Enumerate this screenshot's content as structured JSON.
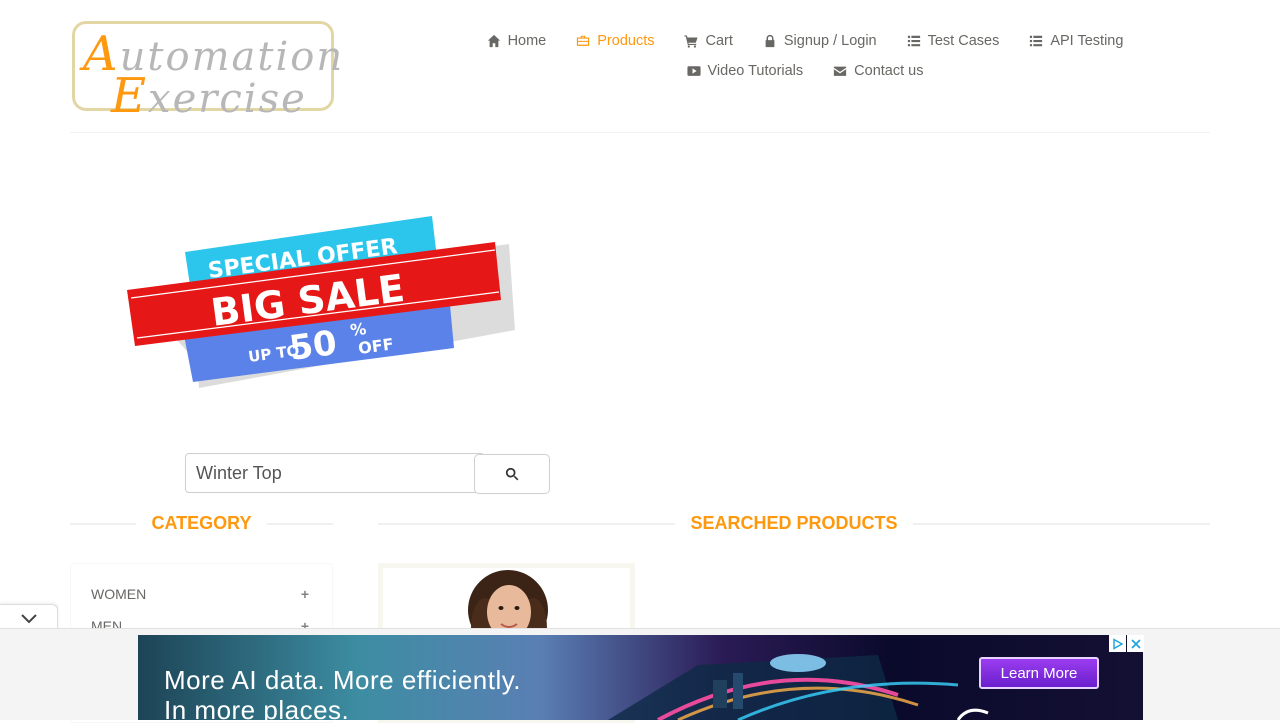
{
  "header": {
    "logo": {
      "line1_cap": "A",
      "line1_rest": "utomation",
      "line2_cap": "E",
      "line2_rest": "xercise"
    },
    "nav": [
      {
        "label": "Home",
        "icon": "home-icon"
      },
      {
        "label": "Products",
        "icon": "briefcase-icon",
        "active": true
      },
      {
        "label": "Cart",
        "icon": "cart-icon"
      },
      {
        "label": "Signup / Login",
        "icon": "lock-icon"
      },
      {
        "label": "Test Cases",
        "icon": "list-icon"
      },
      {
        "label": "API Testing",
        "icon": "list-icon"
      },
      {
        "label": "Video Tutorials",
        "icon": "youtube-icon"
      },
      {
        "label": "Contact us",
        "icon": "envelope-icon"
      }
    ]
  },
  "advert": {
    "special_offer": "SPECIAL OFFER",
    "big_sale": "BIG SALE",
    "up_to": "UP TO",
    "percent": "50",
    "pct_sign": "%",
    "off": "OFF"
  },
  "search": {
    "value": "Winter Top",
    "button_icon": "search-icon"
  },
  "sidebar": {
    "title": "CATEGORY",
    "categories": [
      {
        "label": "WOMEN",
        "expand": "+"
      },
      {
        "label": "MEN",
        "expand": "+"
      }
    ]
  },
  "main": {
    "title": "SEARCHED PRODUCTS"
  },
  "ad": {
    "line1": "More AI data. More efficiently.",
    "line2": "In more places.",
    "cta": "Learn More"
  },
  "colors": {
    "accent": "#fe980f",
    "text": "#696763",
    "ad_cta": "#8a2be2"
  }
}
